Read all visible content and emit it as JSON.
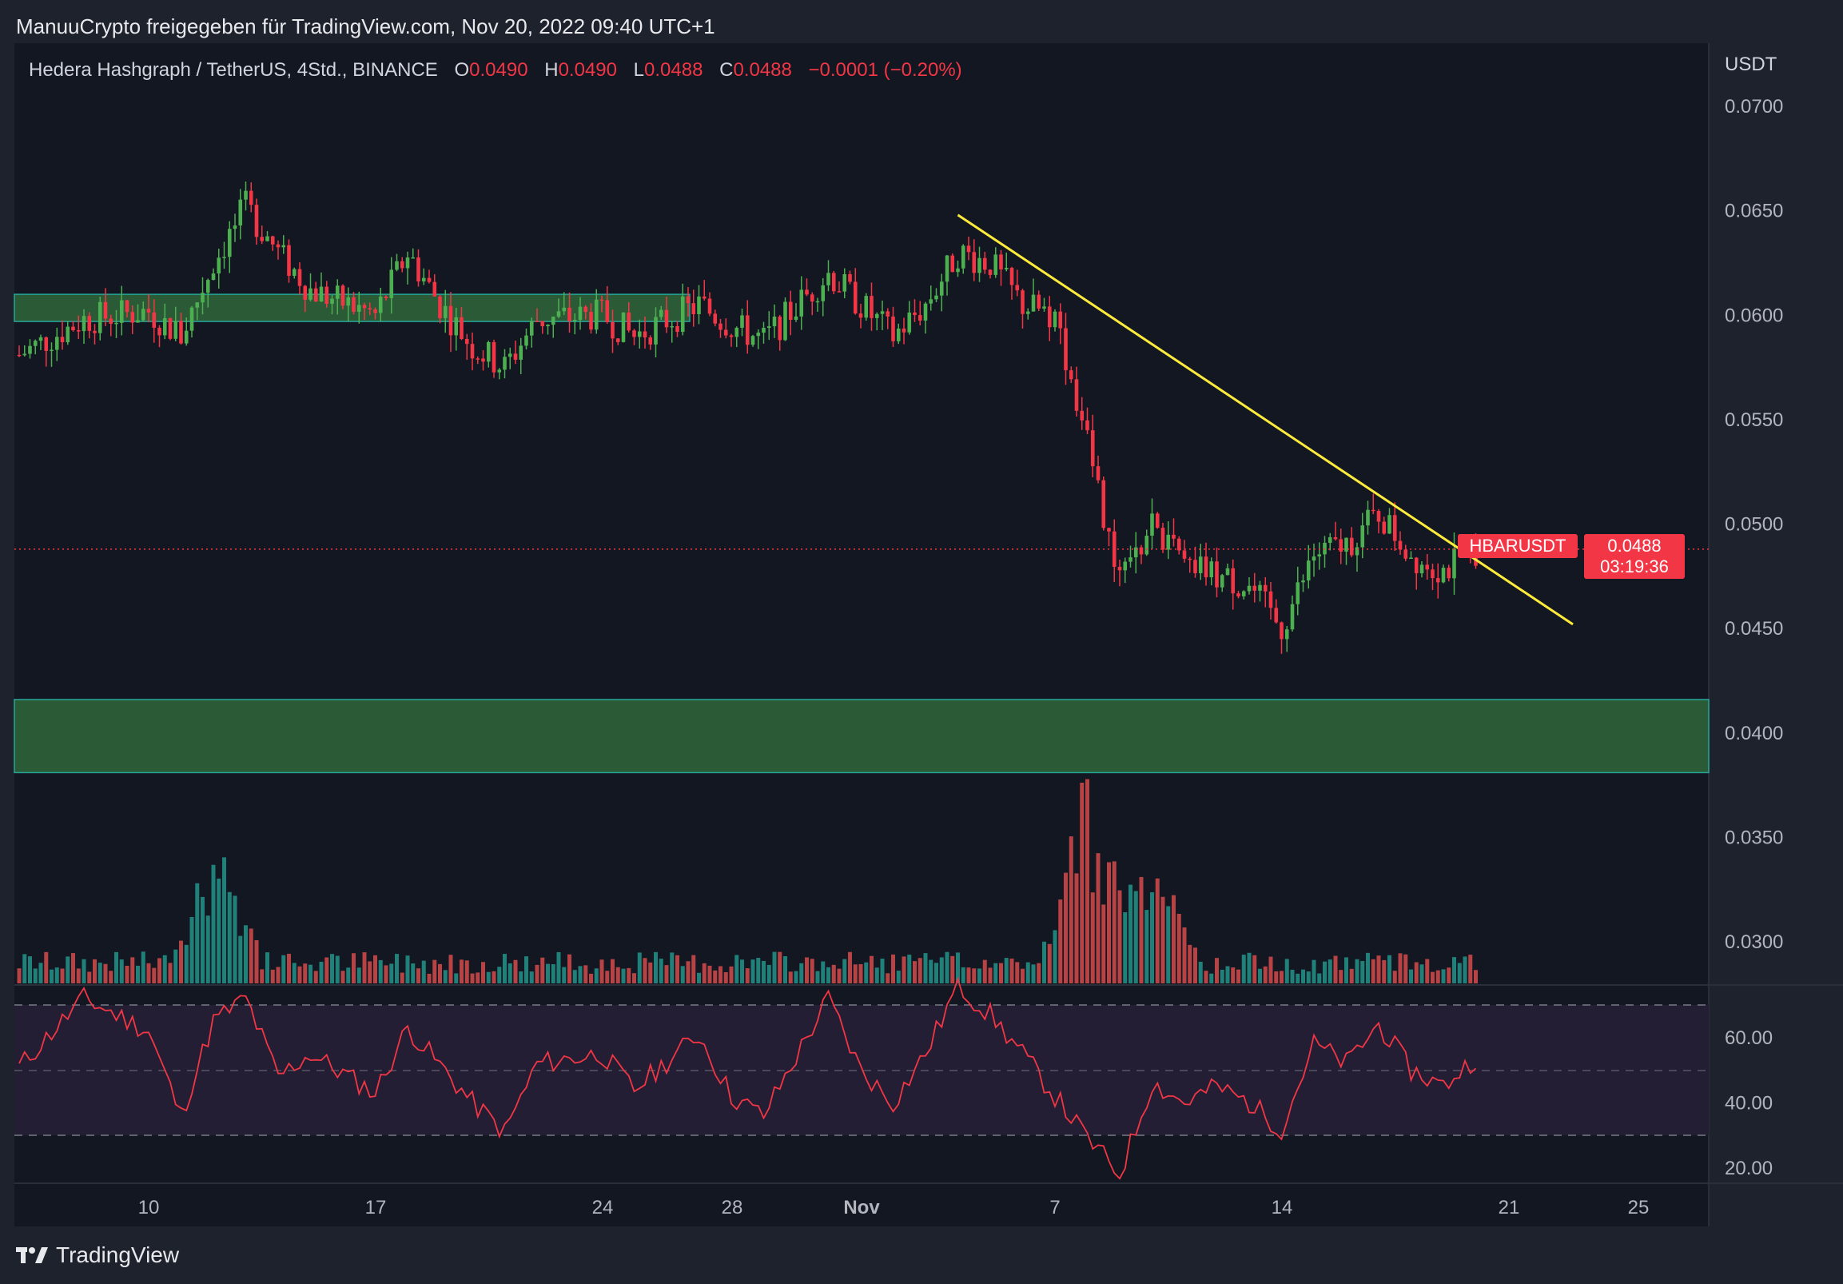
{
  "caption": "ManuuCrypto freigegeben für TradingView.com, Nov 20, 2022 09:40 UTC+1",
  "legend": {
    "title": "Hedera Hashgraph / TetherUS, 4Std., BINANCE",
    "o_label": "O",
    "o_value": "0.0490",
    "h_label": "H",
    "h_value": "0.0490",
    "l_label": "L",
    "l_value": "0.0488",
    "c_label": "C",
    "c_value": "0.0488",
    "change": "−0.0001 (−0.20%)"
  },
  "symbol_tag": "HBARUSDT",
  "price_tag": {
    "price": "0.0488",
    "countdown": "03:19:36"
  },
  "footer_brand": "TradingView",
  "colors": {
    "up": "#26a69a",
    "candle_up": "#4caf50",
    "down": "#f23645",
    "volume_up": "#26a69a",
    "volume_down": "#ef5350",
    "trendline": "#ffeb3b",
    "zone_fill": "#2b5a36",
    "zone_border": "#26a69a",
    "rsi_line": "#f23645",
    "rsi_band": "#231e33"
  },
  "chart_data": [
    {
      "type": "candlestick",
      "pane": "price",
      "axis_unit": "USDT",
      "y_ticks": [
        "0.0700",
        "0.0650",
        "0.0600",
        "0.0550",
        "0.0500",
        "0.0450",
        "0.0400",
        "0.0350",
        "0.0300"
      ],
      "ylim": [
        0.0278,
        0.0718
      ],
      "x_ticks": [
        "10",
        "17",
        "24",
        "28",
        "Nov",
        "7",
        "14",
        "21",
        "25"
      ],
      "current_price": 0.0488,
      "support_zones": [
        [
          0.0597,
          0.061
        ],
        [
          0.0381,
          0.0416
        ]
      ],
      "trendline": {
        "from": [
          "Nov 4",
          0.0648
        ],
        "to": [
          "Nov 23",
          0.0452
        ]
      },
      "approx_close_path": [
        [
          "Oct 6",
          0.0581
        ],
        [
          "Oct 8",
          0.0598
        ],
        [
          "Oct 10",
          0.0602
        ],
        [
          "Oct 11",
          0.059
        ],
        [
          "Oct 12",
          0.0625
        ],
        [
          "Oct 13",
          0.0652
        ],
        [
          "Oct 14",
          0.063
        ],
        [
          "Oct 15",
          0.0612
        ],
        [
          "Oct 17",
          0.06
        ],
        [
          "Oct 18",
          0.063
        ],
        [
          "Oct 19",
          0.0605
        ],
        [
          "Oct 20",
          0.0585
        ],
        [
          "Oct 21",
          0.0575
        ],
        [
          "Oct 22",
          0.0598
        ],
        [
          "Oct 24",
          0.06
        ],
        [
          "Oct 25",
          0.059
        ],
        [
          "Oct 27",
          0.0605
        ],
        [
          "Oct 28",
          0.0595
        ],
        [
          "Oct 29",
          0.0588
        ],
        [
          "Oct 31",
          0.062
        ],
        [
          "Nov 1",
          0.0605
        ],
        [
          "Nov 2",
          0.059
        ],
        [
          "Nov 3",
          0.0605
        ],
        [
          "Nov 4",
          0.063
        ],
        [
          "Nov 5",
          0.0625
        ],
        [
          "Nov 6",
          0.0605
        ],
        [
          "Nov 7",
          0.06
        ],
        [
          "Nov 8",
          0.054
        ],
        [
          "Nov 9",
          0.047
        ],
        [
          "Nov 10",
          0.05
        ],
        [
          "Nov 11",
          0.048
        ],
        [
          "Nov 12",
          0.0475
        ],
        [
          "Nov 13",
          0.047
        ],
        [
          "Nov 14",
          0.045
        ],
        [
          "Nov 15",
          0.0485
        ],
        [
          "Nov 16",
          0.049
        ],
        [
          "Nov 17",
          0.0505
        ],
        [
          "Nov 18",
          0.0485
        ],
        [
          "Nov 19",
          0.0478
        ],
        [
          "Nov 20",
          0.0488
        ]
      ]
    },
    {
      "type": "bar",
      "pane": "volume",
      "description_values": "relative volume per 4h candle; spikes around Oct 12 and Nov 8",
      "approx_peaks": [
        [
          "Oct 12",
          1.0
        ],
        [
          "Nov 8",
          1.28
        ],
        [
          "Nov 10",
          0.78
        ]
      ]
    },
    {
      "type": "line",
      "pane": "rsi",
      "y_ticks": [
        "60.00",
        "40.00",
        "20.00"
      ],
      "ylim": [
        15,
        78
      ],
      "bands": [
        30,
        50,
        70
      ],
      "approx_values": [
        [
          "Oct 6",
          51
        ],
        [
          "Oct 8",
          72
        ],
        [
          "Oct 10",
          62
        ],
        [
          "Oct 11",
          36
        ],
        [
          "Oct 12",
          65
        ],
        [
          "Oct 13",
          72
        ],
        [
          "Oct 14",
          48
        ],
        [
          "Oct 15",
          55
        ],
        [
          "Oct 17",
          43
        ],
        [
          "Oct 18",
          63
        ],
        [
          "Oct 20",
          40
        ],
        [
          "Oct 21",
          31
        ],
        [
          "Oct 22",
          52
        ],
        [
          "Oct 24",
          55
        ],
        [
          "Oct 25",
          44
        ],
        [
          "Oct 27",
          61
        ],
        [
          "Oct 28",
          42
        ],
        [
          "Oct 29",
          36
        ],
        [
          "Oct 31",
          72
        ],
        [
          "Nov 1",
          50
        ],
        [
          "Nov 2",
          40
        ],
        [
          "Nov 3",
          55
        ],
        [
          "Nov 4",
          76
        ],
        [
          "Nov 5",
          67
        ],
        [
          "Nov 6",
          55
        ],
        [
          "Nov 7",
          42
        ],
        [
          "Nov 8",
          29
        ],
        [
          "Nov 9",
          18
        ],
        [
          "Nov 10",
          46
        ],
        [
          "Nov 11",
          40
        ],
        [
          "Nov 12",
          45
        ],
        [
          "Nov 13",
          40
        ],
        [
          "Nov 14",
          32
        ],
        [
          "Nov 15",
          58
        ],
        [
          "Nov 16",
          52
        ],
        [
          "Nov 17",
          64
        ],
        [
          "Nov 18",
          50
        ],
        [
          "Nov 19",
          45
        ],
        [
          "Nov 20",
          54
        ]
      ]
    }
  ]
}
